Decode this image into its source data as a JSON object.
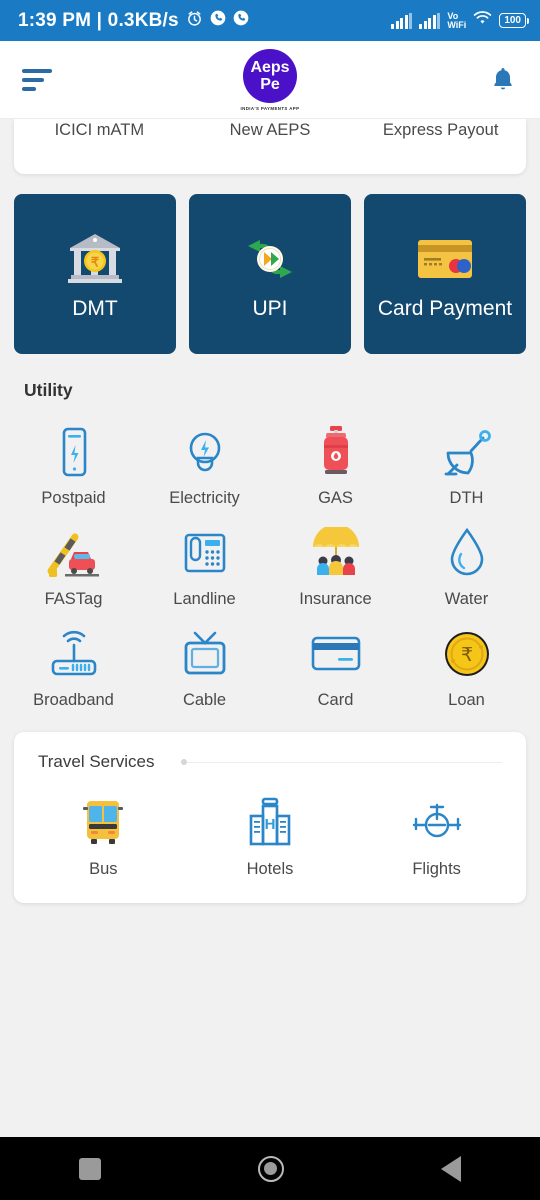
{
  "status_bar": {
    "clock": "1:39 PM | 0.3KB/s",
    "icons_left": [
      "alarm-icon",
      "call-icon",
      "call-icon"
    ],
    "network_label": "Vo",
    "network_label2": "WiFi",
    "battery": "100",
    "background_color": "#1a7bc4"
  },
  "header": {
    "menu_icon": "hamburger-icon",
    "logo_line1": "Aeps",
    "logo_line2": "Pe",
    "logo_tagline": "INDIA'S PAYMENTS APP",
    "logo_color": "#4b11c9",
    "notification_icon": "bell-icon"
  },
  "top_card": {
    "items": [
      {
        "label": "ICICI mATM"
      },
      {
        "label": "New AEPS"
      },
      {
        "label": "Express Payout"
      }
    ]
  },
  "tiles": {
    "accent_color": "#14496f",
    "items": [
      {
        "label": "DMT",
        "icon": "bank-rupee-icon"
      },
      {
        "label": "UPI",
        "icon": "upi-icon"
      },
      {
        "label": "Card Payment",
        "icon": "credit-card-icon"
      }
    ]
  },
  "utility": {
    "title": "Utility",
    "items": [
      {
        "label": "Postpaid",
        "icon": "mobile-phone-icon"
      },
      {
        "label": "Electricity",
        "icon": "light-bulb-icon"
      },
      {
        "label": "GAS",
        "icon": "gas-cylinder-icon"
      },
      {
        "label": "DTH",
        "icon": "satellite-dish-icon"
      },
      {
        "label": "FASTag",
        "icon": "toll-barrier-car-icon"
      },
      {
        "label": "Landline",
        "icon": "landline-telephone-icon"
      },
      {
        "label": "Insurance",
        "icon": "umbrella-family-icon"
      },
      {
        "label": "Water",
        "icon": "water-drop-icon"
      },
      {
        "label": "Broadband",
        "icon": "wifi-router-icon"
      },
      {
        "label": "Cable",
        "icon": "television-icon"
      },
      {
        "label": "Card",
        "icon": "card-outline-icon"
      },
      {
        "label": "Loan",
        "icon": "rupee-coin-icon"
      }
    ]
  },
  "travel": {
    "title": "Travel Services",
    "items": [
      {
        "label": "Bus",
        "icon": "bus-icon"
      },
      {
        "label": "Hotels",
        "icon": "hotel-building-icon"
      },
      {
        "label": "Flights",
        "icon": "airplane-icon"
      }
    ]
  },
  "nav_bar": {
    "recents": "recents-square-icon",
    "home": "home-circle-icon",
    "back": "back-triangle-icon"
  }
}
